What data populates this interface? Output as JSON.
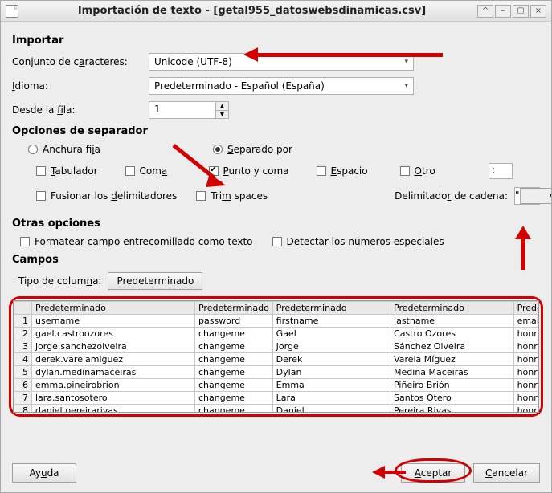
{
  "window": {
    "title": "Importación de texto - [getal955_datoswebsdinamicas.csv]"
  },
  "import": {
    "section": "Importar",
    "charset_label_pre": "Conjunto de c",
    "charset_label_ul": "a",
    "charset_label_post": "racteres:",
    "charset_value": "Unicode (UTF-8)",
    "lang_label_ul": "I",
    "lang_label_post": "dioma:",
    "lang_value": "Predeterminado - Español (España)",
    "fromrow_label_pre": "Desde la ",
    "fromrow_label_ul": "f",
    "fromrow_label_post": "ila:",
    "fromrow_value": "1"
  },
  "sep": {
    "section": "Opciones de separador",
    "fixed_pre": "Anchura fi",
    "fixed_ul": "j",
    "fixed_post": "a",
    "separated_ul": "S",
    "separated_post": "eparado por",
    "tab_ul": "T",
    "tab_post": "abulador",
    "comma_pre": "Com",
    "comma_ul": "a",
    "semicolon_ul": "P",
    "semicolon_post": "unto y coma",
    "space_ul": "E",
    "space_post": "spacio",
    "other_ul": "O",
    "other_post": "tro",
    "other_value": ":",
    "merge_pre": "Fusionar los ",
    "merge_ul": "d",
    "merge_post": "elimitadores",
    "trim_pre": "Tri",
    "trim_ul": "m",
    "trim_post": " spaces",
    "strdelim_label_pre": "Delimitado",
    "strdelim_label_ul": "r",
    "strdelim_label_post": " de cadena:",
    "strdelim_value": "\""
  },
  "other": {
    "section": "Otras opciones",
    "quoted_pre": "F",
    "quoted_ul": "o",
    "quoted_post": "rmatear campo entrecomillado como texto",
    "detect_pre": "Detectar los ",
    "detect_ul": "n",
    "detect_post": "úmeros especiales"
  },
  "fields": {
    "section": "Campos",
    "coltype_label_pre": "Tipo de colum",
    "coltype_label_ul": "n",
    "coltype_label_post": "a:",
    "coltype_value": "Predeterminado",
    "headers": [
      "Predeterminado",
      "Predeterminado",
      "Predeterminado",
      "Predeterminado",
      "Predeterminado"
    ],
    "rows": [
      [
        "username",
        "password",
        "firstname",
        "lastname",
        "email"
      ],
      [
        "gael.castroozores",
        "changeme",
        "Gael",
        "Castro Ozores",
        "honre"
      ],
      [
        "jorge.sanchezolveira",
        "changeme",
        "Jorge",
        "Sánchez Olveira",
        "honre"
      ],
      [
        "derek.varelamiguez",
        "changeme",
        "Derek",
        "Varela Míguez",
        "honre"
      ],
      [
        "dylan.medinamaceiras",
        "changeme",
        "Dylan",
        "Medina Maceiras",
        "honre"
      ],
      [
        "emma.pineirobrion",
        "changeme",
        "Emma",
        "Piñeiro Brión",
        "honre"
      ],
      [
        "lara.santosotero",
        "changeme",
        "Lara",
        "Santos Otero",
        "honre"
      ],
      [
        "daniel.pereirarivas",
        "changeme",
        "Daniel",
        "Pereira Rivas",
        "honre"
      ]
    ]
  },
  "buttons": {
    "help_pre": "Ay",
    "help_ul": "u",
    "help_post": "da",
    "ok_ul": "A",
    "ok_post": "ceptar",
    "cancel_ul": "C",
    "cancel_post": "ancelar"
  }
}
